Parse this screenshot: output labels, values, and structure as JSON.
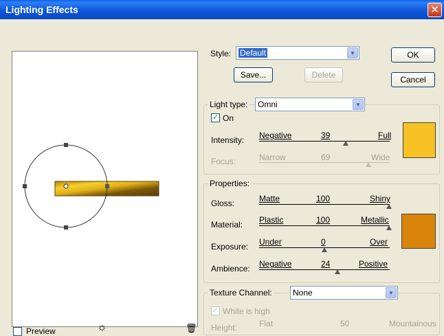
{
  "window": {
    "title": "Lighting Effects"
  },
  "style": {
    "label": "Style:",
    "value": "Default",
    "save": "Save...",
    "delete": "Delete"
  },
  "buttons": {
    "ok": "OK",
    "cancel": "Cancel"
  },
  "light": {
    "type_label": "Light type:",
    "type_value": "Omni",
    "on_label": "On",
    "on_checked": true,
    "intensity": {
      "label": "Intensity:",
      "min": "Negative",
      "value": "39",
      "max": "Full",
      "level": 0.59
    },
    "focus": {
      "label": "Focus:",
      "min": "Narrow",
      "value": "69",
      "max": "Wide",
      "level": 0.84,
      "disabled": true
    },
    "color": "#f8c224"
  },
  "properties": {
    "label": "Properties:",
    "gloss": {
      "label": "Gloss:",
      "min": "Matte",
      "value": "100",
      "max": "Shiny",
      "level": 1.0
    },
    "material": {
      "label": "Material:",
      "min": "Plastic",
      "value": "100",
      "max": "Metallic",
      "level": 1.0
    },
    "exposure": {
      "label": "Exposure:",
      "min": "Under",
      "value": "0",
      "max": "Over",
      "level": 0.5
    },
    "ambience": {
      "label": "Ambience:",
      "min": "Negative",
      "value": "24",
      "max": "Positive",
      "level": 0.62
    },
    "color": "#d9850b"
  },
  "texture": {
    "label": "Texture Channel:",
    "value": "None",
    "white_high_label": "White is high",
    "height": {
      "label": "Height:",
      "min": "Flat",
      "value": "50",
      "max": "Mountainous"
    }
  },
  "preview": {
    "footer_label": "Preview"
  }
}
